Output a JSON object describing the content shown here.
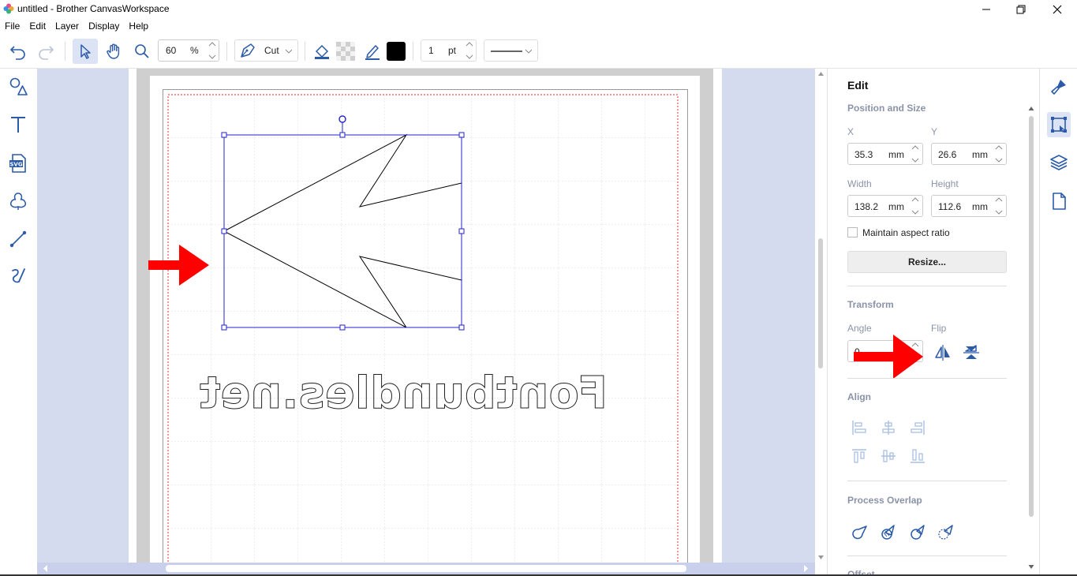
{
  "window": {
    "title": "untitled - Brother CanvasWorkspace"
  },
  "menu": [
    "File",
    "Edit",
    "Layer",
    "Display",
    "Help"
  ],
  "toolbar": {
    "zoom_value": "60",
    "zoom_unit": "%",
    "mode_label": "Cut",
    "line_width_value": "1",
    "line_width_unit": "pt",
    "fill_color": "#000000",
    "accent_color": "#2255aa"
  },
  "canvas": {
    "mirrored_text": "Fontbundles.net",
    "selection_color": "#2222cc",
    "annotation_arrow_color": "#ff0000"
  },
  "panel": {
    "title": "Edit",
    "position_size": {
      "section": "Position and Size",
      "x_label": "X",
      "x_value": "35.3",
      "y_label": "Y",
      "y_value": "26.6",
      "width_label": "Width",
      "width_value": "138.2",
      "height_label": "Height",
      "height_value": "112.6",
      "unit": "mm",
      "maintain_aspect_label": "Maintain aspect ratio",
      "maintain_aspect_checked": false,
      "resize_button": "Resize..."
    },
    "transform": {
      "section": "Transform",
      "angle_label": "Angle",
      "angle_value": "0",
      "flip_label": "Flip"
    },
    "align": {
      "section": "Align"
    },
    "process_overlap": {
      "section": "Process Overlap"
    },
    "next_section": "Offset"
  }
}
